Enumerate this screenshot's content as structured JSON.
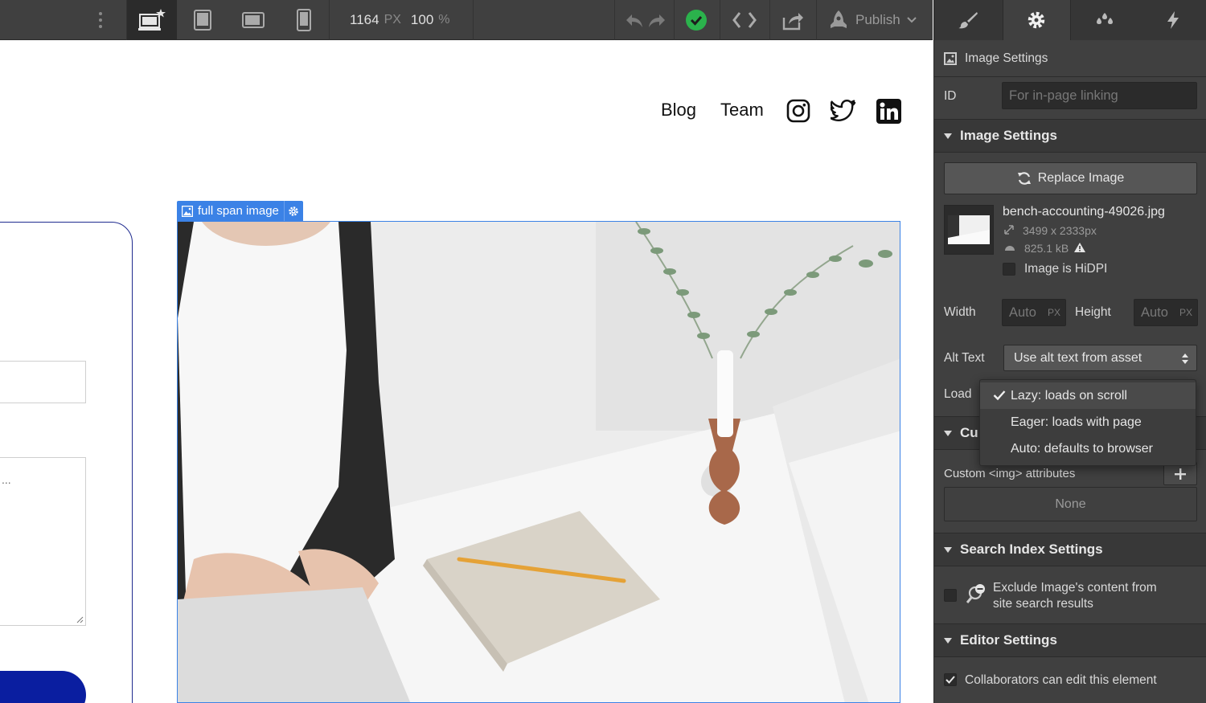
{
  "toolbar": {
    "zoom_width": "1164",
    "zoom_width_unit": "PX",
    "zoom_percent": "100",
    "zoom_percent_unit": "%",
    "publish_label": "Publish",
    "icons": [
      "more-vertical-icon",
      "desktop-star-icon",
      "tablet-icon",
      "tablet-landscape-icon",
      "mobile-icon",
      "undo-icon",
      "redo-icon",
      "check-circle-icon",
      "code-icon",
      "export-icon",
      "rocket-icon",
      "chevron-down-icon"
    ],
    "status_color": "#2bb24c"
  },
  "panel": {
    "tabs": [
      "brush-icon",
      "gear-icon",
      "drops-icon",
      "lightning-icon"
    ],
    "header_title": "Image Settings",
    "id_label": "ID",
    "id_placeholder": "For in-page linking",
    "section_image_settings": "Image Settings",
    "replace_image_label": "Replace Image",
    "file_name": "bench-accounting-49026.jpg",
    "file_dimensions": "3499 x 2333px",
    "file_size": "825.1 kB",
    "hidpi_label": "Image is HiDPI",
    "width_label": "Width",
    "width_value": "Auto",
    "width_unit": "PX",
    "height_label": "Height",
    "height_value": "Auto",
    "height_unit": "PX",
    "alt_label": "Alt Text",
    "alt_value": "Use alt text from asset",
    "load_label": "Load",
    "load_options": [
      "Lazy: loads on scroll",
      "Eager: loads with page",
      "Auto: defaults to browser"
    ],
    "load_selected": "Lazy: loads on scroll",
    "section_custom_partial": "Cu",
    "custom_attrs_label": "Custom <img> attributes",
    "custom_attrs_value": "None",
    "section_search": "Search Index Settings",
    "exclude_label_line1": "Exclude Image's content from",
    "exclude_label_line2": "site search results",
    "section_editor": "Editor Settings",
    "collab_label": "Collaborators can edit this element"
  },
  "canvas": {
    "nav_links": [
      "Blog",
      "Team"
    ],
    "social_icons": [
      "instagram-icon",
      "twitter-icon",
      "linkedin-icon"
    ],
    "selection_label": "full span image",
    "form_ellipsis": "..."
  }
}
